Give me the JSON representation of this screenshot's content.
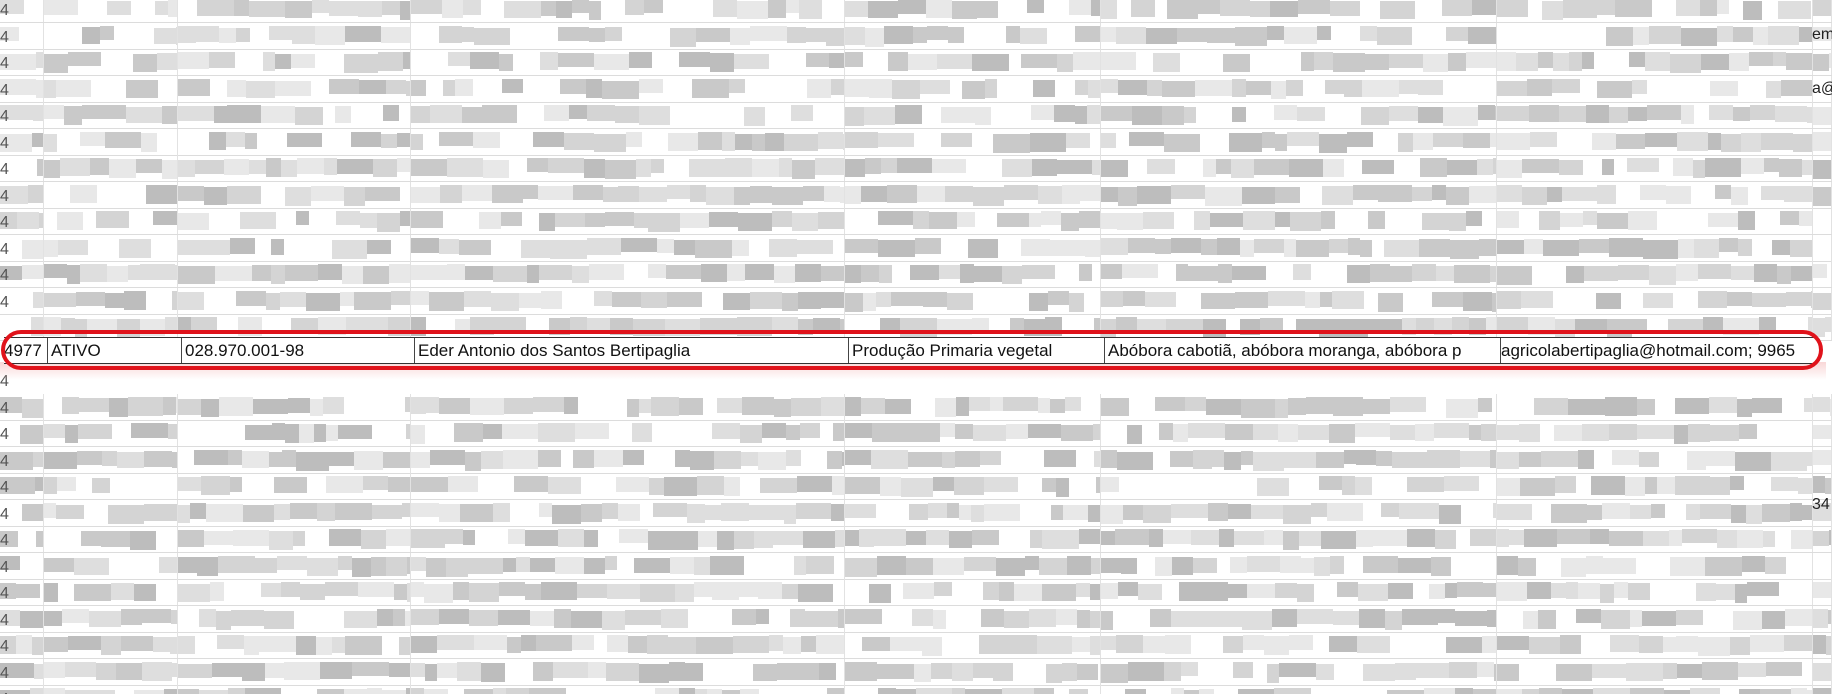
{
  "highlighted_row": {
    "cells": [
      "4977",
      "ATIVO",
      "028.970.001-98",
      "Eder Antonio dos Santos Bertipaglia",
      "Produção Primaria vegetal",
      "Abóbora cabotiã, abóbora moranga, abóbora p",
      "agricolabertipaglia@hotmail.com; 9965"
    ]
  },
  "edge_fragments": {
    "row_label_digit": "4",
    "right_col_a": "em",
    "right_col_b": "a@",
    "right_col_c": "34"
  },
  "colors": {
    "highlight_ring": "#e0131b",
    "grid_line": "#dcdcdc",
    "pixelated": [
      "#c9c9c9",
      "#d4d4d4",
      "#dedede",
      "#e8e8e8",
      "#bdbdbd"
    ]
  }
}
